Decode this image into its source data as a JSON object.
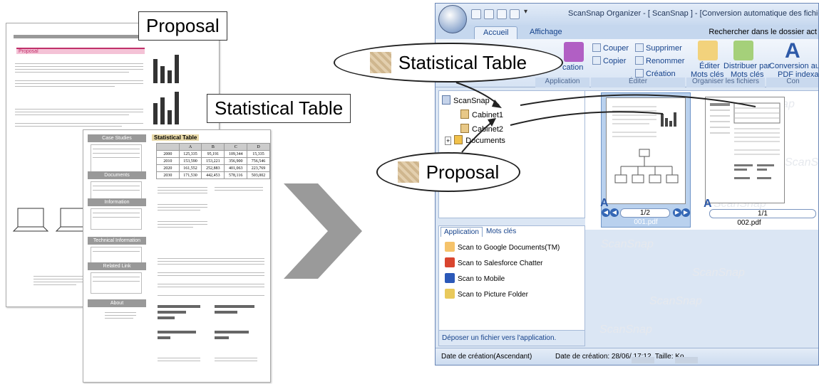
{
  "paper1": {
    "tab_label": "Proposal"
  },
  "paper2": {
    "sidebar": [
      "Case Studies",
      "Documents",
      "Information",
      "Technical Information",
      "Related Link",
      "About"
    ],
    "table_title": "Statistical Table",
    "table_header": [
      "",
      "A",
      "B",
      "C",
      "D"
    ],
    "table_rows": [
      [
        "2000",
        "125,335",
        "95,191",
        "109,344",
        "15,335"
      ],
      [
        "2010",
        "153,590",
        "153,221",
        "356,900",
        "756,546"
      ],
      [
        "2020",
        "161,552",
        "252,883",
        "401,063",
        "223,769"
      ],
      [
        "2030",
        "171,530",
        "442,453",
        "578,116",
        "503,002"
      ]
    ]
  },
  "callouts_left": {
    "proposal": "Proposal",
    "statistical_table": "Statistical Table"
  },
  "window": {
    "title": "ScanSnap Organizer - [ ScanSnap ] - [Conversion automatique des fichiers PDF ajoutés au forma",
    "tabs": [
      "Accueil",
      "Affichage"
    ],
    "search_text": "Rechercher dans le dossier act",
    "ribbon": {
      "couper": "Couper",
      "supprimer": "Supprimer",
      "copier": "Copier",
      "renommer": "Renommer",
      "creation": "Création",
      "application_frag": "cation",
      "editer_btn_line1": "Éditer",
      "editer_btn_line2": "Mots clés",
      "distribuer_line1": "Distribuer par",
      "distribuer_line2": "Mots clés",
      "conversion_line1": "Conversion au forma",
      "conversion_line2": "PDF indexable",
      "grp_application": "Application",
      "grp_editer": "Éditer",
      "grp_organiser": "Organiser les fichiers",
      "grp_con": "Con"
    },
    "tree": [
      "ScanSnap",
      "Cabinet1",
      "Cabinet2",
      "Documents"
    ],
    "docs": [
      {
        "pager": "1/2",
        "name": "001.pdf"
      },
      {
        "pager": "1/1",
        "name": "002.pdf"
      }
    ],
    "app_tabs": [
      "Application",
      "Mots clés"
    ],
    "apps": [
      "Scan to Google Documents(TM)",
      "Scan to Salesforce Chatter",
      "Scan to Mobile",
      "Scan to Picture Folder"
    ],
    "drop_hint": "Déposer un fichier vers l'application.",
    "status_sort": "Date de création(Ascendant)",
    "status_date_prefix": "Date de création: 28/06/",
    "status_time_size": "17:12, Taille:",
    "status_unit": "Ko",
    "watermark": "ScanSnap"
  },
  "balloons": {
    "statistical_table": "Statistical Table",
    "proposal": "Proposal"
  }
}
